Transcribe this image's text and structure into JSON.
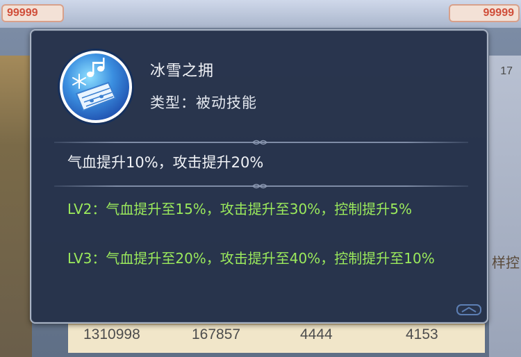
{
  "background": {
    "coin_left": "99999",
    "coin_right": "99999",
    "right_number": "17",
    "right_side_text": "样控",
    "stats": [
      "1310998",
      "167857",
      "4444",
      "4153"
    ]
  },
  "tooltip": {
    "skill_icon": "ice-snow-music-icon",
    "skill_name": "冰雪之拥",
    "skill_type": "类型：被动技能",
    "description": "气血提升10%，攻击提升20%",
    "levels": [
      {
        "text": "LV2：气血提升至15%，攻击提升至30%，控制提升5%"
      },
      {
        "text": "LV3：气血提升至20%，攻击提升至40%，控制提升至10%"
      }
    ]
  },
  "colors": {
    "panel_bg": "#243048",
    "level_text": "#9bea5c",
    "title_text": "#f2f4f8"
  }
}
